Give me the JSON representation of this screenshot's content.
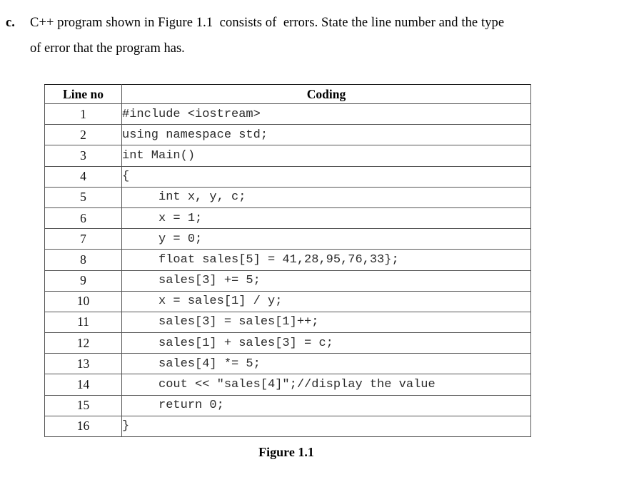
{
  "question": {
    "label": "c.",
    "line1": "C++ program shown in Figure 1.1  consists of  errors. State the line number and the type",
    "line2": "of error that the program has."
  },
  "table": {
    "headers": {
      "lineno": "Line no",
      "coding": "Coding"
    },
    "rows": [
      {
        "lineno": "1",
        "code": "#include <iostream>"
      },
      {
        "lineno": "2",
        "code": "using namespace std;"
      },
      {
        "lineno": "3",
        "code": "int Main()"
      },
      {
        "lineno": "4",
        "code": "{"
      },
      {
        "lineno": "5",
        "code": "     int x, y, c;"
      },
      {
        "lineno": "6",
        "code": "     x = 1;"
      },
      {
        "lineno": "7",
        "code": "     y = 0;"
      },
      {
        "lineno": "8",
        "code": "     float sales[5] = 41,28,95,76,33};"
      },
      {
        "lineno": "9",
        "code": "     sales[3] += 5;"
      },
      {
        "lineno": "10",
        "code": "     x = sales[1] / y;"
      },
      {
        "lineno": "11",
        "code": "     sales[3] = sales[1]++;"
      },
      {
        "lineno": "12",
        "code": "     sales[1] + sales[3] = c;"
      },
      {
        "lineno": "13",
        "code": "     sales[4] *= 5;"
      },
      {
        "lineno": "14",
        "code": "     cout << \"sales[4]\";//display the value"
      },
      {
        "lineno": "15",
        "code": "     return 0;"
      },
      {
        "lineno": "16",
        "code": "}"
      }
    ]
  },
  "figure": {
    "caption": "Figure 1.1"
  },
  "colors": {
    "page_background": "#ffffff",
    "text": "#000000",
    "code_text": "#2b2b2b",
    "table_border": "#555555",
    "table_top_border": "#1a1a1a"
  }
}
